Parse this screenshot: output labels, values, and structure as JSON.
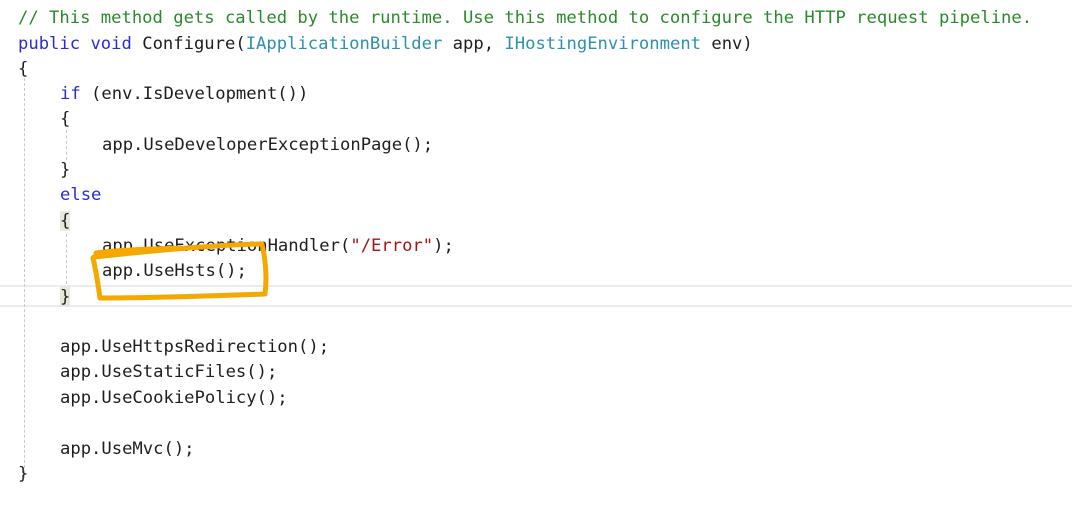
{
  "code": {
    "lines": [
      {
        "comment": "// This method gets called by the runtime. Use this method to configure the HTTP request pipeline."
      },
      {
        "kw1": "public",
        "kw2": "void",
        "name": "Configure(",
        "type1": "IApplicationBuilder",
        "arg1": " app, ",
        "type2": "IHostingEnvironment",
        "arg2": " env)"
      },
      {
        "text": "{"
      },
      {
        "kw": "if",
        "text": " (env.IsDevelopment())"
      },
      {
        "text": "{"
      },
      {
        "text": "app.UseDeveloperExceptionPage();"
      },
      {
        "text": "}"
      },
      {
        "kw": "else"
      },
      {
        "text": "{"
      },
      {
        "pre": "app.UseExceptionHandler(",
        "str": "\"/Error\"",
        "post": ");"
      },
      {
        "text": "app.UseHsts();"
      },
      {
        "text": "}"
      },
      {
        "text": "app.UseHttpsRedirection();"
      },
      {
        "text": "app.UseStaticFiles();"
      },
      {
        "text": "app.UseCookiePolicy();"
      },
      {
        "text": "app.UseMvc();"
      },
      {
        "text": "}"
      }
    ]
  },
  "annotation": {
    "target": "app.UseHsts();",
    "color": "#f5a800"
  }
}
